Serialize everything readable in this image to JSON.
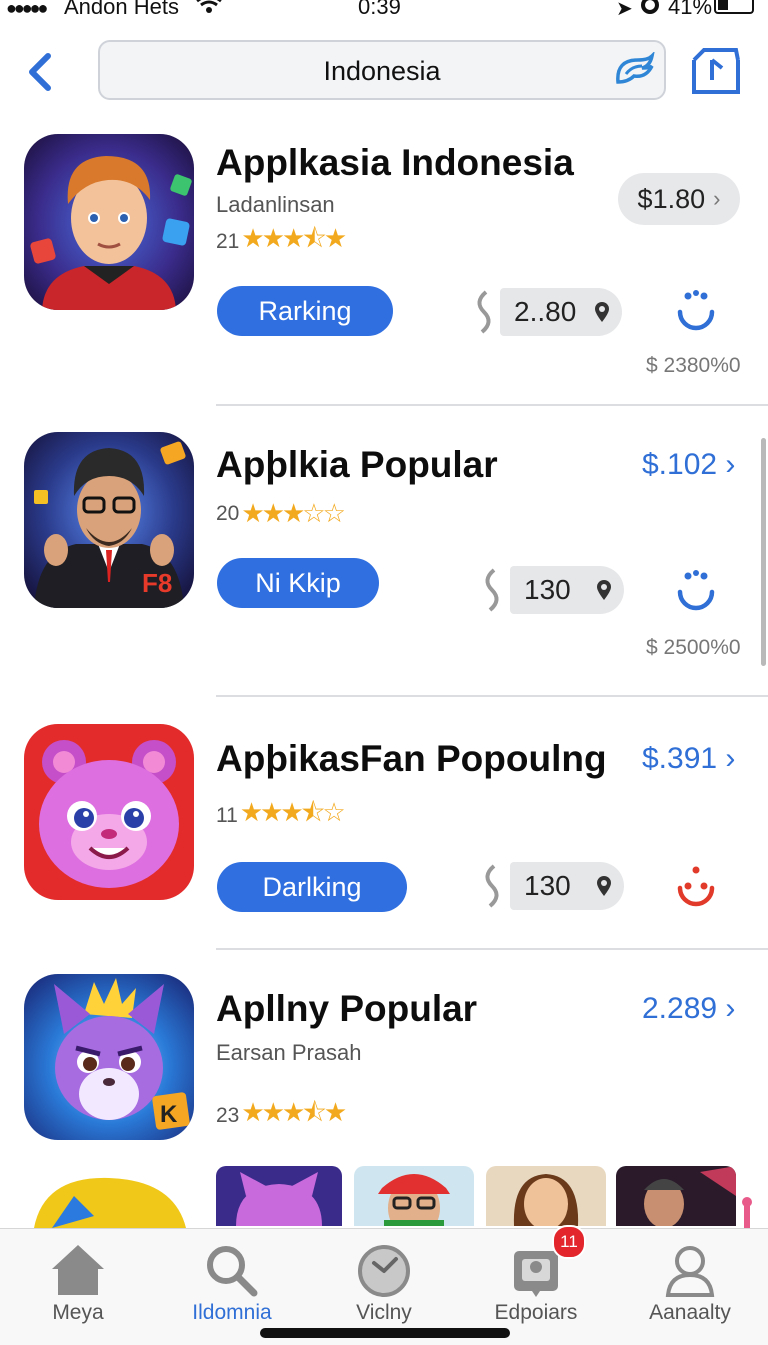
{
  "status_bar": {
    "signal_dots": "●●●●●",
    "carrier": "Andon Hets",
    "time": "0:39",
    "battery_percent": "41%"
  },
  "search": {
    "query": "Indonesia"
  },
  "apps": [
    {
      "title": "Applkasia Indonesia",
      "subtitle": "Ladanlinsan",
      "rating_count": "21",
      "stars": "★★★⯪★",
      "price": "$1.80",
      "button": "Rarking",
      "count": "2..80",
      "sub_price": "$ 2380%0"
    },
    {
      "title": "Apþlkia Popular",
      "rating_count": "20",
      "stars": "★★★☆☆",
      "price": "$.102 ›",
      "button": "Ni Kkip",
      "count": "130",
      "sub_price": "$ 2500%0"
    },
    {
      "title": "ApþikasFan Popoulng",
      "rating_count": "11",
      "stars": "★★★⯪☆",
      "price": "$.391 ›",
      "button": "Darlking",
      "count": "130"
    },
    {
      "title": "Apllny Popular",
      "subtitle": "Earsan Prasah",
      "rating_count": "23",
      "stars": "★★★⯪★",
      "price": "2.289 ›"
    }
  ],
  "tabs": [
    {
      "label": "Meya",
      "icon": "home-icon"
    },
    {
      "label": "Ildomnia",
      "icon": "search-icon",
      "active": true
    },
    {
      "label": "Viclny",
      "icon": "clock-icon"
    },
    {
      "label": "Edpoiars",
      "icon": "updates-icon",
      "badge": "11"
    },
    {
      "label": "Aanaalty",
      "icon": "person-icon"
    }
  ],
  "colors": {
    "accent": "#2f6fd6",
    "button_blue": "#2f6fe0",
    "star": "#f2a91e",
    "badge_red": "#e2262c"
  }
}
